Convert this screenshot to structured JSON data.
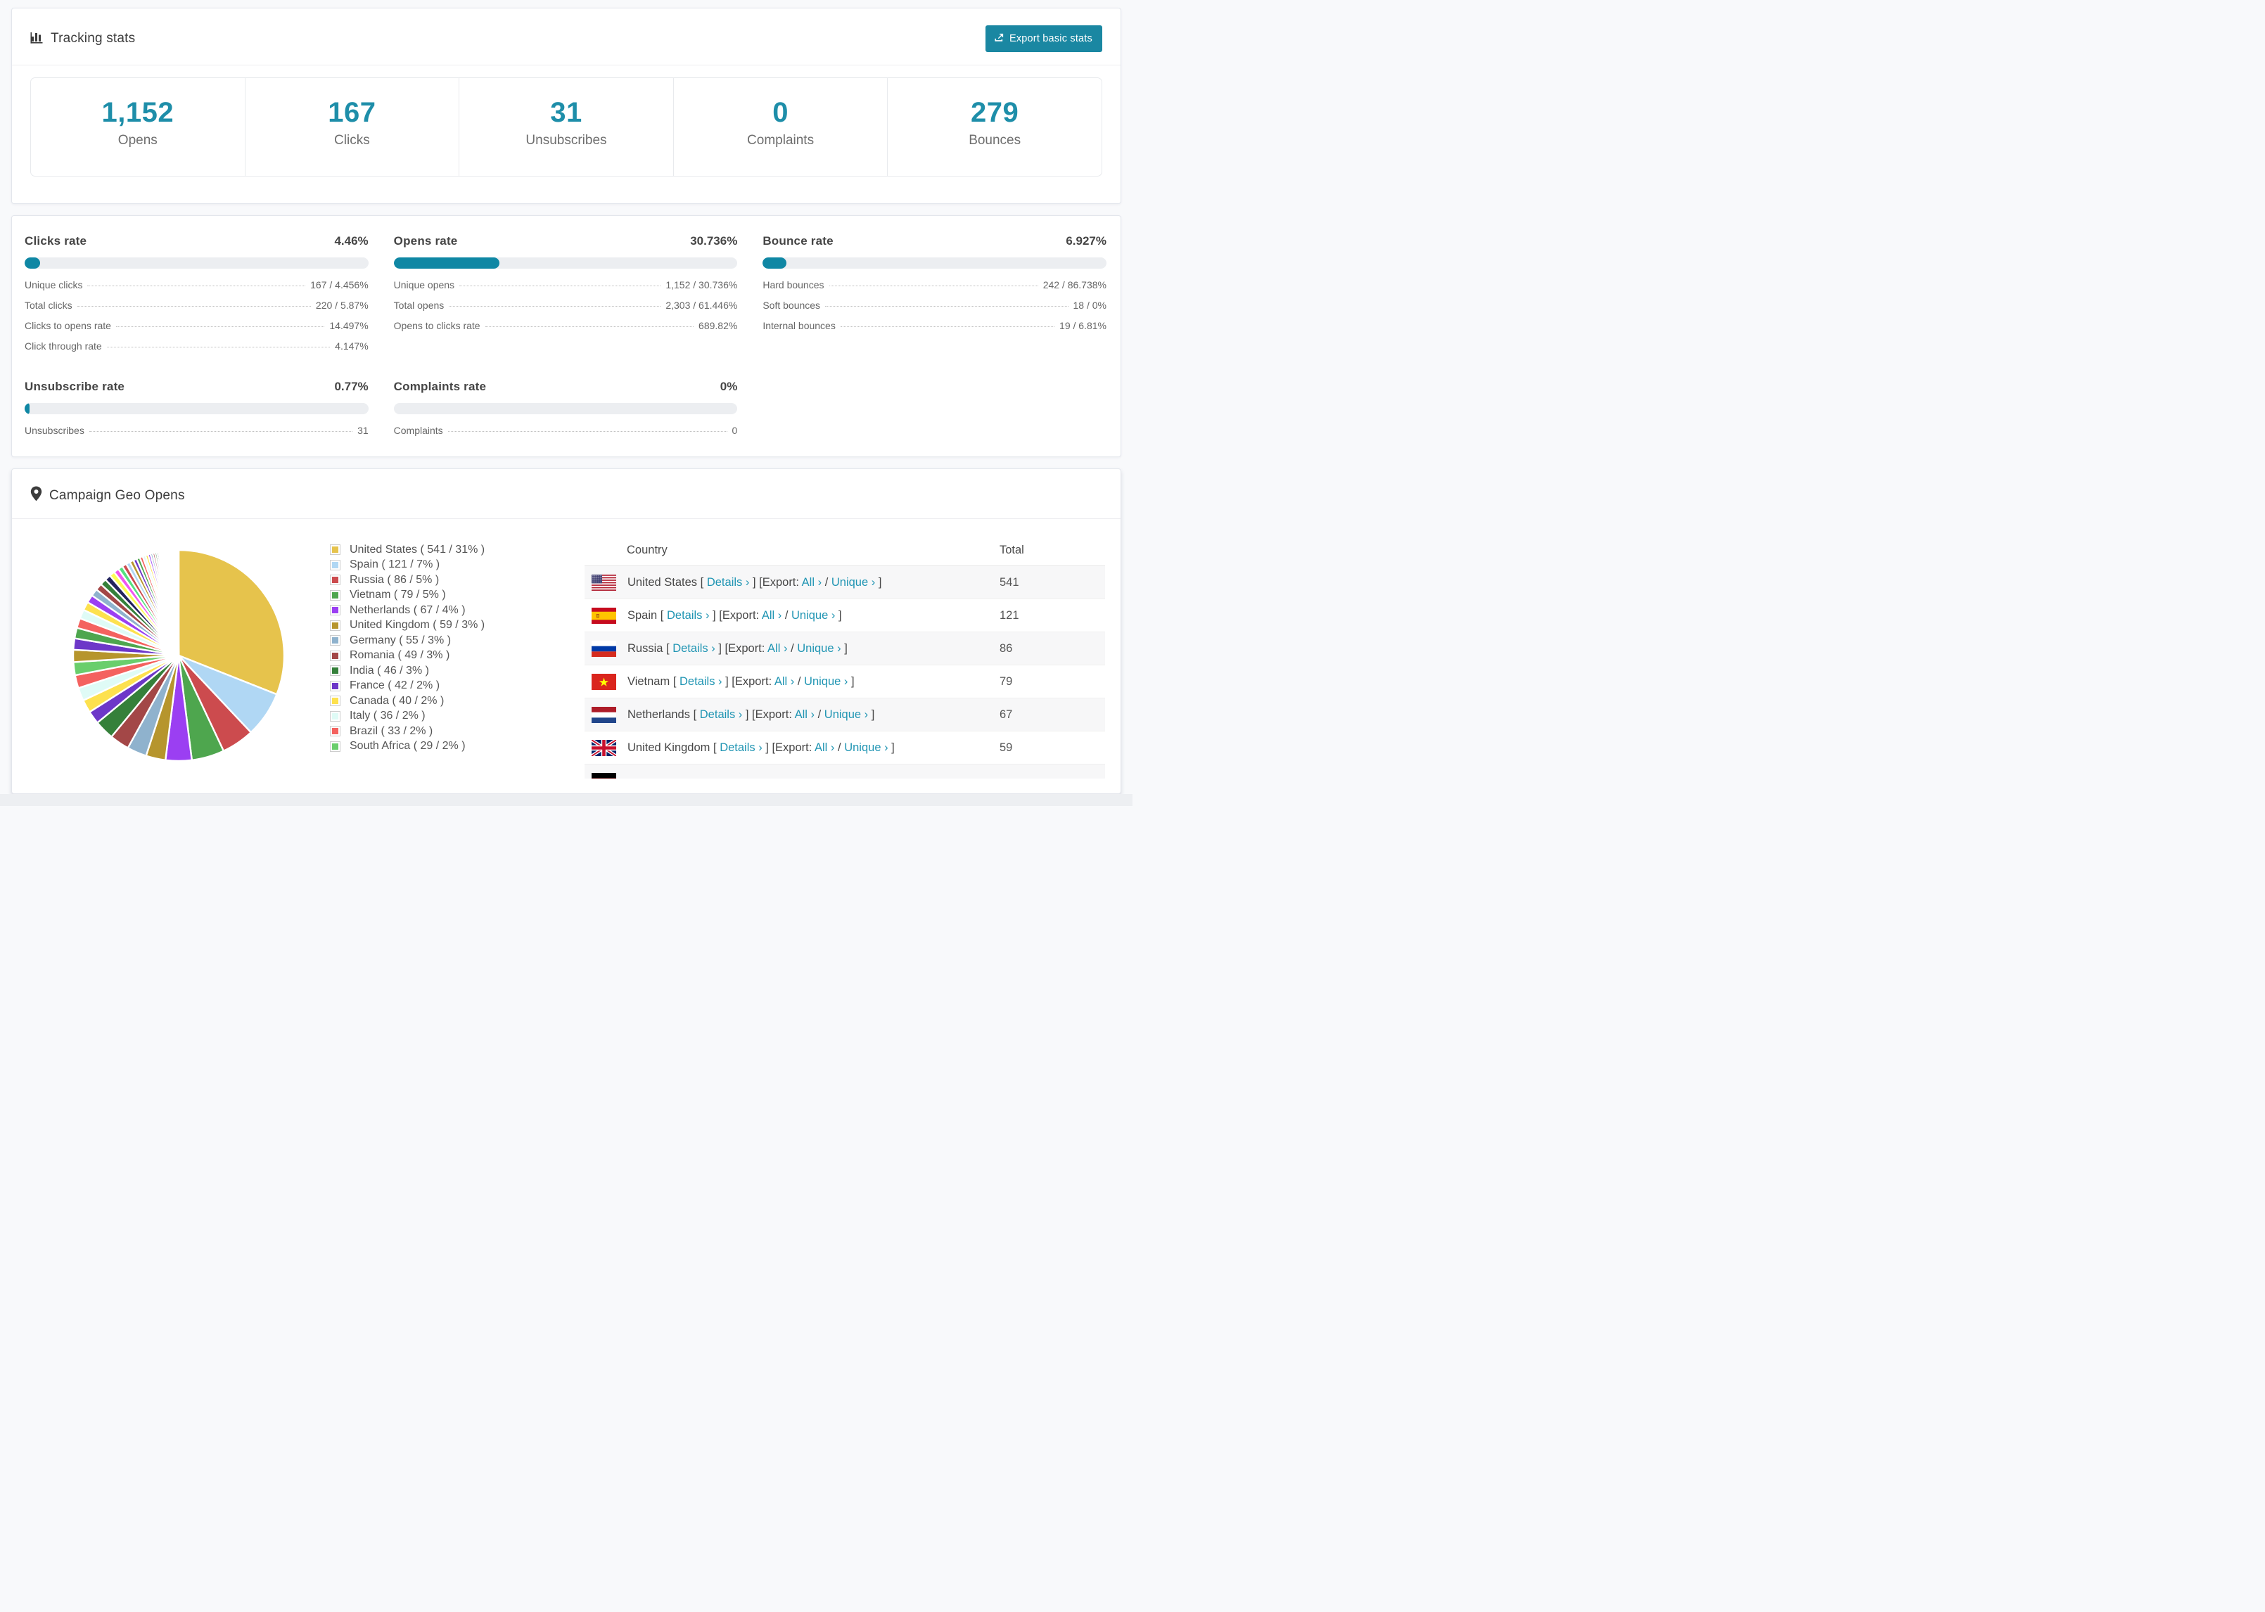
{
  "colors": {
    "accent_teal": "#1e8ea9",
    "button_teal": "#1a87a2",
    "progress_teal": "#0f87a4",
    "link_teal": "#2095b3"
  },
  "tracking": {
    "title": "Tracking stats",
    "export_button": "Export basic stats",
    "stats": [
      {
        "value": "1,152",
        "label": "Opens"
      },
      {
        "value": "167",
        "label": "Clicks"
      },
      {
        "value": "31",
        "label": "Unsubscribes"
      },
      {
        "value": "0",
        "label": "Complaints"
      },
      {
        "value": "279",
        "label": "Bounces"
      }
    ]
  },
  "rates": {
    "blocks": [
      {
        "id": "clicks",
        "title": "Clicks rate",
        "value": "4.46%",
        "pct": 4.46,
        "rows": [
          {
            "label": "Unique clicks",
            "value": "167 / 4.456%"
          },
          {
            "label": "Total clicks",
            "value": "220 / 5.87%"
          },
          {
            "label": "Clicks to opens rate",
            "value": "14.497%"
          },
          {
            "label": "Click through rate",
            "value": "4.147%"
          }
        ]
      },
      {
        "id": "opens",
        "title": "Opens rate",
        "value": "30.736%",
        "pct": 30.736,
        "rows": [
          {
            "label": "Unique opens",
            "value": "1,152 / 30.736%"
          },
          {
            "label": "Total opens",
            "value": "2,303 / 61.446%"
          },
          {
            "label": "Opens to clicks rate",
            "value": "689.82%"
          }
        ]
      },
      {
        "id": "bounce",
        "title": "Bounce rate",
        "value": "6.927%",
        "pct": 6.927,
        "rows": [
          {
            "label": "Hard bounces",
            "value": "242 / 86.738%"
          },
          {
            "label": "Soft bounces",
            "value": "18 / 0%"
          },
          {
            "label": "Internal bounces",
            "value": "19 / 6.81%"
          }
        ]
      },
      {
        "id": "unsubscribe",
        "title": "Unsubscribe rate",
        "value": "0.77%",
        "pct": 0.77,
        "rows": [
          {
            "label": "Unsubscribes",
            "value": "31"
          }
        ]
      },
      {
        "id": "complaints",
        "title": "Complaints rate",
        "value": "0%",
        "pct": 0,
        "rows": [
          {
            "label": "Complaints",
            "value": "0"
          }
        ]
      }
    ]
  },
  "geo": {
    "title": "Campaign Geo Opens",
    "table": {
      "headers": [
        "Country",
        "Total"
      ],
      "link_details": "Details ›",
      "link_all": "All ›",
      "link_unique": "Unique ›",
      "fmt_open": "[",
      "fmt_export": "] [Export:",
      "fmt_slash": " / ",
      "fmt_close": "]",
      "rows": [
        {
          "flag": "us",
          "country": "United States",
          "total": "541"
        },
        {
          "flag": "es",
          "country": "Spain",
          "total": "121"
        },
        {
          "flag": "ru",
          "country": "Russia",
          "total": "86"
        },
        {
          "flag": "vn",
          "country": "Vietnam",
          "total": "79"
        },
        {
          "flag": "nl",
          "country": "Netherlands",
          "total": "67"
        },
        {
          "flag": "gb",
          "country": "United Kingdom",
          "total": "59"
        },
        {
          "flag": "de",
          "partial": true
        }
      ]
    }
  },
  "chart_data": {
    "type": "pie",
    "title": "Campaign Geo Opens",
    "legend_position": "right",
    "start_angle_deg": -90,
    "direction": "clockwise",
    "categories": [
      "United States",
      "Spain",
      "Russia",
      "Vietnam",
      "Netherlands",
      "United Kingdom",
      "Germany",
      "Romania",
      "India",
      "France",
      "Canada",
      "Italy",
      "Brazil",
      "South Africa"
    ],
    "values": [
      541,
      121,
      86,
      79,
      67,
      59,
      55,
      49,
      46,
      42,
      40,
      36,
      33,
      29
    ],
    "pcts": [
      31,
      7,
      5,
      5,
      4,
      3,
      3,
      3,
      3,
      2,
      2,
      2,
      2,
      2
    ],
    "colors": [
      "#e6c34c",
      "#b0d7f4",
      "#cc4b4e",
      "#4ea64e",
      "#9b3ff2",
      "#b6952d",
      "#8fb2cd",
      "#a34747",
      "#35803a",
      "#6d37c8",
      "#fde14e",
      "#dffbf6",
      "#f4625f",
      "#69ce6c"
    ],
    "legend_labels": [
      "United States ( 541 / 31% )",
      "Spain ( 121 / 7% )",
      "Russia ( 86 / 5% )",
      "Vietnam ( 79 / 5% )",
      "Netherlands ( 67 / 4% )",
      "United Kingdom ( 59 / 3% )",
      "Germany ( 55 / 3% )",
      "Romania ( 49 / 3% )",
      "India ( 46 / 3% )",
      "France ( 42 / 2% )",
      "Canada ( 40 / 2% )",
      "Italy ( 36 / 2% )",
      "Brazil ( 33 / 2% )",
      "South Africa ( 29 / 2% )"
    ],
    "others": {
      "note": "many small unlabeled country slices filling the remainder",
      "count": 50,
      "total_pct": 26,
      "decay": 0.93,
      "colors": [
        "#b6952d",
        "#6d37c8",
        "#4ea64e",
        "#f4625f",
        "#dffbf6",
        "#fde14e",
        "#9b3ff2",
        "#8fb2cd",
        "#a34747",
        "#35803a",
        "#23245e",
        "#fdfd55",
        "#f055f0",
        "#55e07f",
        "#cc4b4e",
        "#b0d7f4"
      ]
    }
  }
}
